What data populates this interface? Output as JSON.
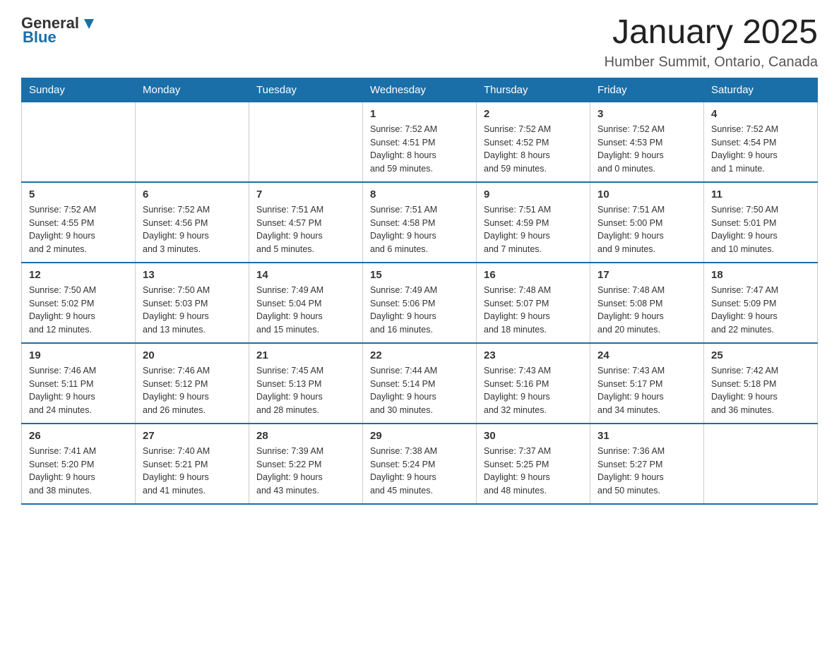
{
  "header": {
    "logo_general": "General",
    "logo_blue": "Blue",
    "title": "January 2025",
    "subtitle": "Humber Summit, Ontario, Canada"
  },
  "days_of_week": [
    "Sunday",
    "Monday",
    "Tuesday",
    "Wednesday",
    "Thursday",
    "Friday",
    "Saturday"
  ],
  "weeks": [
    {
      "days": [
        {
          "num": "",
          "info": ""
        },
        {
          "num": "",
          "info": ""
        },
        {
          "num": "",
          "info": ""
        },
        {
          "num": "1",
          "info": "Sunrise: 7:52 AM\nSunset: 4:51 PM\nDaylight: 8 hours\nand 59 minutes."
        },
        {
          "num": "2",
          "info": "Sunrise: 7:52 AM\nSunset: 4:52 PM\nDaylight: 8 hours\nand 59 minutes."
        },
        {
          "num": "3",
          "info": "Sunrise: 7:52 AM\nSunset: 4:53 PM\nDaylight: 9 hours\nand 0 minutes."
        },
        {
          "num": "4",
          "info": "Sunrise: 7:52 AM\nSunset: 4:54 PM\nDaylight: 9 hours\nand 1 minute."
        }
      ]
    },
    {
      "days": [
        {
          "num": "5",
          "info": "Sunrise: 7:52 AM\nSunset: 4:55 PM\nDaylight: 9 hours\nand 2 minutes."
        },
        {
          "num": "6",
          "info": "Sunrise: 7:52 AM\nSunset: 4:56 PM\nDaylight: 9 hours\nand 3 minutes."
        },
        {
          "num": "7",
          "info": "Sunrise: 7:51 AM\nSunset: 4:57 PM\nDaylight: 9 hours\nand 5 minutes."
        },
        {
          "num": "8",
          "info": "Sunrise: 7:51 AM\nSunset: 4:58 PM\nDaylight: 9 hours\nand 6 minutes."
        },
        {
          "num": "9",
          "info": "Sunrise: 7:51 AM\nSunset: 4:59 PM\nDaylight: 9 hours\nand 7 minutes."
        },
        {
          "num": "10",
          "info": "Sunrise: 7:51 AM\nSunset: 5:00 PM\nDaylight: 9 hours\nand 9 minutes."
        },
        {
          "num": "11",
          "info": "Sunrise: 7:50 AM\nSunset: 5:01 PM\nDaylight: 9 hours\nand 10 minutes."
        }
      ]
    },
    {
      "days": [
        {
          "num": "12",
          "info": "Sunrise: 7:50 AM\nSunset: 5:02 PM\nDaylight: 9 hours\nand 12 minutes."
        },
        {
          "num": "13",
          "info": "Sunrise: 7:50 AM\nSunset: 5:03 PM\nDaylight: 9 hours\nand 13 minutes."
        },
        {
          "num": "14",
          "info": "Sunrise: 7:49 AM\nSunset: 5:04 PM\nDaylight: 9 hours\nand 15 minutes."
        },
        {
          "num": "15",
          "info": "Sunrise: 7:49 AM\nSunset: 5:06 PM\nDaylight: 9 hours\nand 16 minutes."
        },
        {
          "num": "16",
          "info": "Sunrise: 7:48 AM\nSunset: 5:07 PM\nDaylight: 9 hours\nand 18 minutes."
        },
        {
          "num": "17",
          "info": "Sunrise: 7:48 AM\nSunset: 5:08 PM\nDaylight: 9 hours\nand 20 minutes."
        },
        {
          "num": "18",
          "info": "Sunrise: 7:47 AM\nSunset: 5:09 PM\nDaylight: 9 hours\nand 22 minutes."
        }
      ]
    },
    {
      "days": [
        {
          "num": "19",
          "info": "Sunrise: 7:46 AM\nSunset: 5:11 PM\nDaylight: 9 hours\nand 24 minutes."
        },
        {
          "num": "20",
          "info": "Sunrise: 7:46 AM\nSunset: 5:12 PM\nDaylight: 9 hours\nand 26 minutes."
        },
        {
          "num": "21",
          "info": "Sunrise: 7:45 AM\nSunset: 5:13 PM\nDaylight: 9 hours\nand 28 minutes."
        },
        {
          "num": "22",
          "info": "Sunrise: 7:44 AM\nSunset: 5:14 PM\nDaylight: 9 hours\nand 30 minutes."
        },
        {
          "num": "23",
          "info": "Sunrise: 7:43 AM\nSunset: 5:16 PM\nDaylight: 9 hours\nand 32 minutes."
        },
        {
          "num": "24",
          "info": "Sunrise: 7:43 AM\nSunset: 5:17 PM\nDaylight: 9 hours\nand 34 minutes."
        },
        {
          "num": "25",
          "info": "Sunrise: 7:42 AM\nSunset: 5:18 PM\nDaylight: 9 hours\nand 36 minutes."
        }
      ]
    },
    {
      "days": [
        {
          "num": "26",
          "info": "Sunrise: 7:41 AM\nSunset: 5:20 PM\nDaylight: 9 hours\nand 38 minutes."
        },
        {
          "num": "27",
          "info": "Sunrise: 7:40 AM\nSunset: 5:21 PM\nDaylight: 9 hours\nand 41 minutes."
        },
        {
          "num": "28",
          "info": "Sunrise: 7:39 AM\nSunset: 5:22 PM\nDaylight: 9 hours\nand 43 minutes."
        },
        {
          "num": "29",
          "info": "Sunrise: 7:38 AM\nSunset: 5:24 PM\nDaylight: 9 hours\nand 45 minutes."
        },
        {
          "num": "30",
          "info": "Sunrise: 7:37 AM\nSunset: 5:25 PM\nDaylight: 9 hours\nand 48 minutes."
        },
        {
          "num": "31",
          "info": "Sunrise: 7:36 AM\nSunset: 5:27 PM\nDaylight: 9 hours\nand 50 minutes."
        },
        {
          "num": "",
          "info": ""
        }
      ]
    }
  ]
}
